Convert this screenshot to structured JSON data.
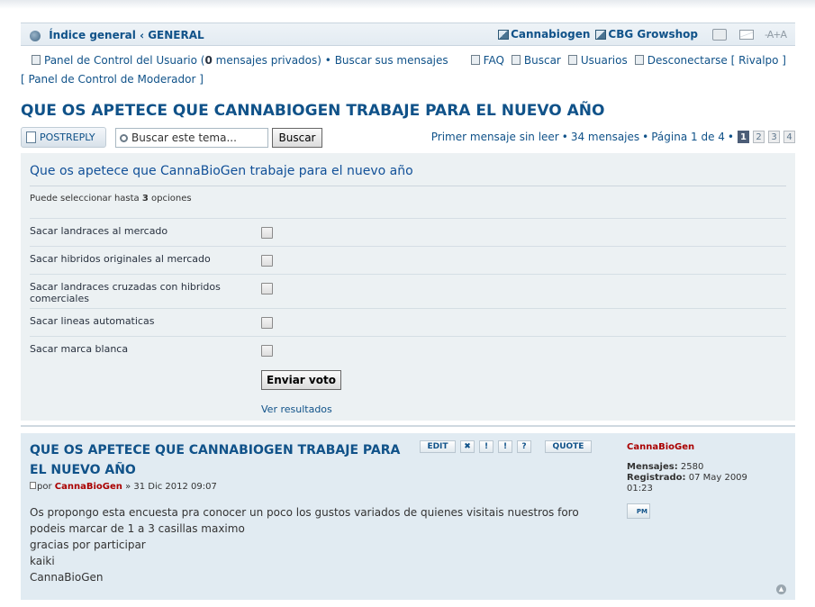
{
  "breadcrumb": {
    "home": "Índice general",
    "separator": "‹",
    "forum": "GENERAL"
  },
  "header_links": {
    "link1": "Cannabiogen",
    "link2": "CBG Growshop",
    "font_size": "-A+A"
  },
  "user_nav": {
    "ucp_label": "Panel de Control del Usuario (",
    "pm_count": "0",
    "pm_suffix": "mensajes privados)",
    "bullet": "•",
    "search_own": "Buscar sus mensajes",
    "faq": "FAQ",
    "search": "Buscar",
    "users": "Usuarios",
    "logout": "Desconectarse [ Rivalpo ]",
    "mcp": "[ Panel de Control de Moderador ]"
  },
  "topic": {
    "title": "QUE OS APETECE QUE CANNABIOGEN TRABAJE PARA EL NUEVO AÑO"
  },
  "actionbar": {
    "post_reply": "POSTREPLY",
    "search_placeholder": "Buscar este tema...",
    "search_button": "Buscar",
    "first_unread": "Primer mensaje sin leer",
    "count_text": "34 mensajes",
    "page_text": "Página 1 de 4",
    "pages": [
      "1",
      "2",
      "3",
      "4"
    ],
    "bullet": "•"
  },
  "poll": {
    "title": "Que os apetece que CannaBioGen trabaje para el nuevo año",
    "note_prefix": "Puede seleccionar hasta",
    "note_count": "3",
    "note_suffix": "opciones",
    "options": [
      "Sacar landraces al mercado",
      "Sacar hibridos originales al mercado",
      "Sacar landraces cruzadas con hibridos comerciales",
      "Sacar lineas automaticas",
      "Sacar marca blanca"
    ],
    "vote_button": "Enviar voto",
    "results_link": "Ver resultados"
  },
  "post": {
    "title": "QUE OS APETECE QUE CANNABIOGEN TRABAJE PARA EL NUEVO AÑO",
    "buttons": {
      "edit": "EDIT",
      "delete": "✖",
      "report": "!",
      "info": "!",
      "warn": "?",
      "quote": "QUOTE"
    },
    "by": "por",
    "author": "CannaBioGen",
    "date": "» 31 Dic 2012 09:07",
    "lines": [
      "Os propongo esta encuesta pra conocer un poco los gustos variados de quienes visitais nuestros foro",
      "podeis marcar de 1 a 3 casillas maximo",
      "gracias por participar",
      "kaiki",
      "CannaBioGen"
    ],
    "profile": {
      "username": "CannaBioGen",
      "posts_label": "Mensajes:",
      "posts_value": "2580",
      "reg_label": "Registrado:",
      "reg_value": "07 May 2009 01:23",
      "pm": "PM"
    }
  }
}
